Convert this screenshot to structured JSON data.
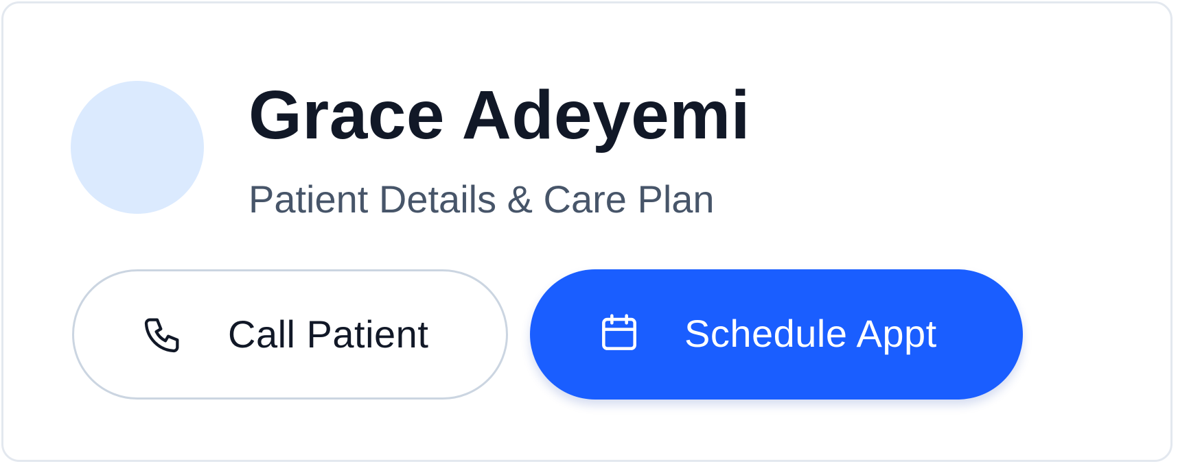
{
  "patient": {
    "name": "Grace Adeyemi",
    "subtitle": "Patient Details & Care Plan"
  },
  "actions": {
    "call": {
      "label": "Call Patient",
      "icon": "phone-icon"
    },
    "schedule": {
      "label": "Schedule Appt",
      "icon": "calendar-icon"
    }
  },
  "colors": {
    "primary": "#1a5eff",
    "avatar_bg": "#dbeafe",
    "title_text": "#111827",
    "subtitle_text": "#475569",
    "outline_border": "#cbd5e1",
    "card_border": "#e3e8ef"
  }
}
